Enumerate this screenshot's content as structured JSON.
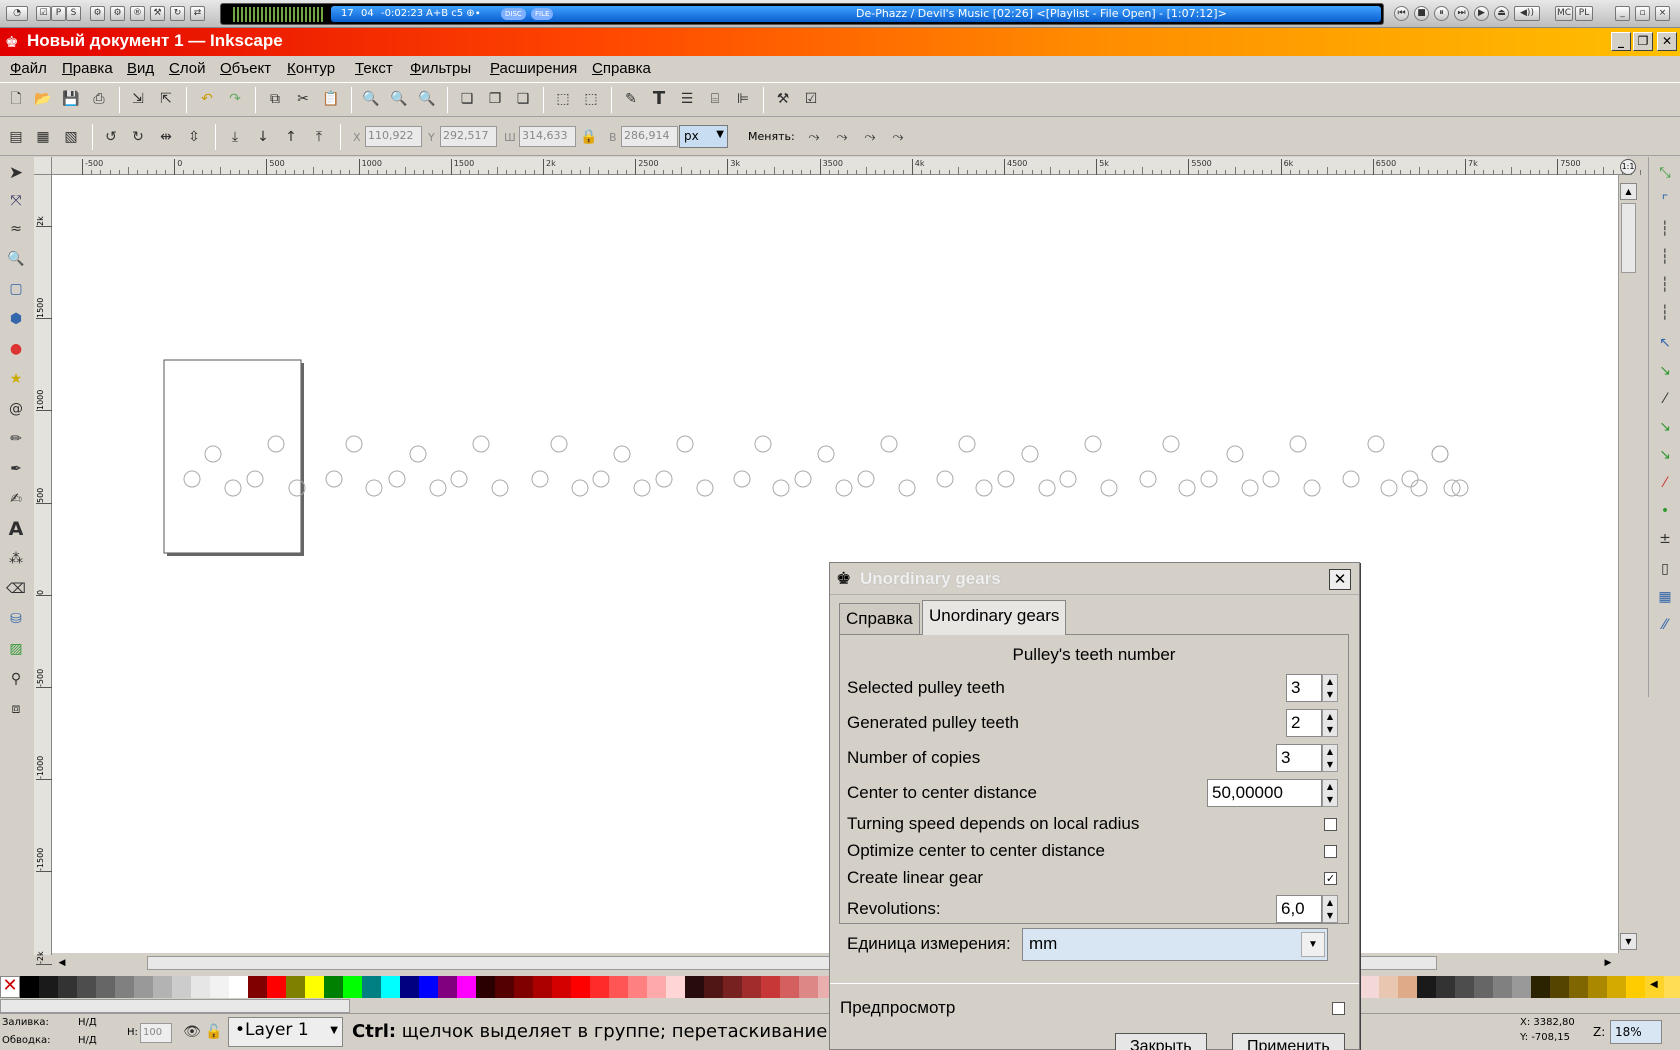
{
  "media": {
    "time_a": "17",
    "time_b": "04",
    "time_c": "-0:02:23",
    "info": "A+B c5 ⊕∙",
    "track": "De-Phazz / Devil's Music  [02:26]     <[Playlist - File Open] - [1:07:12]>",
    "btn_mc": "MC",
    "btn_pl": "PL",
    "badge_disc": "DISC",
    "badge_file": "FILE"
  },
  "window": {
    "title": "Новый документ 1 — Inkscape"
  },
  "menu": [
    "Файл",
    "Правка",
    "Вид",
    "Слой",
    "Объект",
    "Контур",
    "Текст",
    "Фильтры",
    "Расширения",
    "Справка"
  ],
  "toolbar2": {
    "x_label": "X",
    "x_value": "110,922",
    "y_label": "Y",
    "y_value": "292,517",
    "w_label": "Ш",
    "w_value": "314,633",
    "h_label": "В",
    "h_value": "286,914",
    "unit": "px",
    "change_label": "Менять:"
  },
  "ruler": {
    "top_ticks": [
      "-500",
      "0",
      "500",
      "1000",
      "1500",
      "2k",
      "2500",
      "3k",
      "3500",
      "4k",
      "4500",
      "5k",
      "5500",
      "6k",
      "6500",
      "7k",
      "7500"
    ],
    "left_ticks": [
      "2k",
      "1500",
      "1000",
      "500",
      "0",
      "-500",
      "-1000",
      "-1500",
      "-2k"
    ]
  },
  "dialog": {
    "title": "Unordinary gears",
    "tab_help": "Справка",
    "tab_gears": "Unordinary gears",
    "section_title": "Pulley's teeth number",
    "selected_teeth_label": "Selected pulley teeth",
    "selected_teeth_value": "3",
    "generated_teeth_label": "Generated pulley teeth",
    "generated_teeth_value": "2",
    "copies_label": "Number of copies",
    "copies_value": "3",
    "distance_label": "Center to center distance",
    "distance_value": "50,00000",
    "turning_label": "Turning speed depends on local radius",
    "optimize_label": "Optimize center to center distance",
    "linear_label": "Create linear gear",
    "revolutions_label": "Revolutions:",
    "revolutions_value": "6,0",
    "unit_label": "Единица измерения:",
    "unit_value": "mm",
    "preview_label": "Предпросмотр",
    "close_button": "Закрыть",
    "apply_button": "Применить",
    "checks": {
      "turning": false,
      "optimize": false,
      "linear": true,
      "preview": false
    }
  },
  "status": {
    "fill_label": "Заливка:",
    "fill_value": "Н/Д",
    "stroke_label": "Обводка:",
    "stroke_value": "Н/Д",
    "h_label": "Н:",
    "h_value": "100",
    "layer": "•Layer 1",
    "message_key": "Ctrl:",
    "message": " щелчок выделяет в группе; перетаскивание дви",
    "coord_x": "X: 3382,80",
    "coord_y": "Y: -708,15",
    "zoom_label": "Z:",
    "zoom_value": "18%"
  },
  "palette": [
    "#000000",
    "#1a1a1a",
    "#333333",
    "#4d4d4d",
    "#666666",
    "#808080",
    "#999999",
    "#b3b3b3",
    "#cccccc",
    "#e6e6e6",
    "#f2f2f2",
    "#ffffff",
    "#800000",
    "#ff0000",
    "#808000",
    "#ffff00",
    "#008000",
    "#00ff00",
    "#008080",
    "#00ffff",
    "#000080",
    "#0000ff",
    "#800080",
    "#ff00ff",
    "#2b0000",
    "#550000",
    "#800000",
    "#aa0000",
    "#d40000",
    "#ff0000",
    "#ff2a2a",
    "#ff5555",
    "#ff8080",
    "#ffaaaa",
    "#ffd5d5",
    "#280b0b",
    "#501616",
    "#782121",
    "#a02c2c",
    "#c83737",
    "#d35f5f",
    "#de8787",
    "#e9afaf",
    "#f4d7d7"
  ],
  "palette_right": [
    "#f4d7d7",
    "#e9c6af",
    "#deaa87",
    "#1a1a1a",
    "#333333",
    "#4d4d4d",
    "#666666",
    "#808080",
    "#999999",
    "#2b2200",
    "#554400",
    "#806600",
    "#aa8800",
    "#d4aa00",
    "#ffcc00",
    "#ffd42a",
    "#ffdd55",
    "#ffe680"
  ]
}
